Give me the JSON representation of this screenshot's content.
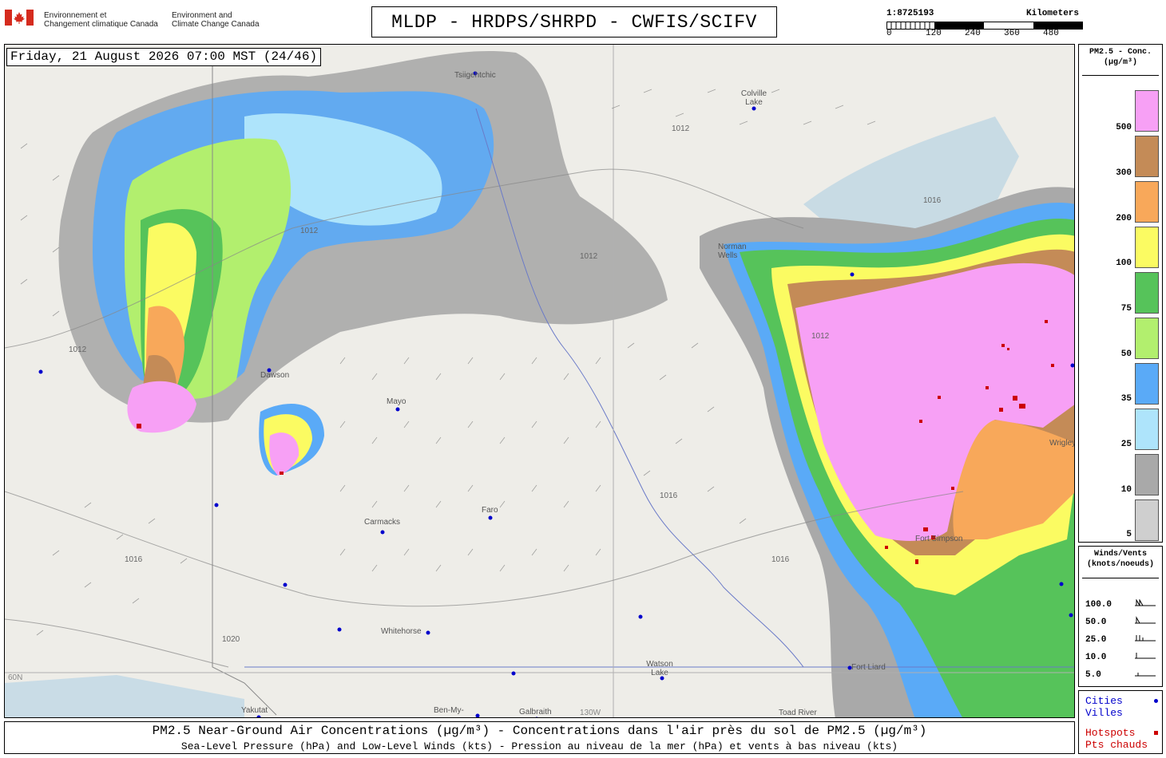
{
  "header": {
    "gov_fr_line1": "Environnement et",
    "gov_fr_line2": "Changement climatique Canada",
    "gov_en_line1": "Environment and",
    "gov_en_line2": "Climate Change Canada",
    "title": "MLDP - HRDPS/SHRPD - CWFIS/SCIFV",
    "scale_ratio": "1:8725193",
    "scale_unit": "Kilometers",
    "scale_ticks": [
      "0",
      "120",
      "240",
      "360",
      "480"
    ]
  },
  "datetime": "Friday, 21 August 2026 07:00 MST (24/46)",
  "map_labels": {
    "cities": [
      "Tsiigehtchic",
      "Colville Lake",
      "Mayo",
      "Dawson",
      "Carmacks",
      "Faro",
      "Whitehorse",
      "Watson Lake",
      "Fort Liard",
      "Yakutat",
      "Ben-My-",
      "Galbraith",
      "Toad River",
      "Norman Wells",
      "Fort Simpson",
      "Wrigley"
    ],
    "isobars": [
      "1012",
      "1016",
      "1020"
    ],
    "graticule": [
      "60N",
      "130W"
    ]
  },
  "legend": {
    "title_line1": "PM2.5 - Conc.",
    "title_line2": "(µg/m³)",
    "bins": [
      {
        "label": "500",
        "color": "#f7a0f5"
      },
      {
        "label": "300",
        "color": "#c48b57"
      },
      {
        "label": "200",
        "color": "#f8a85a"
      },
      {
        "label": "100",
        "color": "#fbfb62"
      },
      {
        "label": "75",
        "color": "#56c35a"
      },
      {
        "label": "50",
        "color": "#b2ef6e"
      },
      {
        "label": "35",
        "color": "#5aaaf7"
      },
      {
        "label": "25",
        "color": "#aee4fb"
      },
      {
        "label": "10",
        "color": "#a9a9a9"
      },
      {
        "label": "5",
        "color": "#cfcfcf"
      }
    ]
  },
  "winds": {
    "title_line1": "Winds/Vents",
    "title_line2": "(knots/noeuds)",
    "rows": [
      "100.0",
      "50.0",
      "25.0",
      "10.0",
      "5.0"
    ]
  },
  "key": {
    "cities_en": "Cities",
    "cities_fr": "Villes",
    "hotspots_en": "Hotspots",
    "hotspots_fr": "Pts chauds",
    "city_color": "#0000cc",
    "hotspot_color": "#cc0000"
  },
  "caption": {
    "line1": "PM2.5 Near-Ground Air Concentrations (µg/m³) - Concentrations dans l'air près du sol de PM2.5 (µg/m³)",
    "line2": "Sea-Level Pressure (hPa) and Low-Level Winds (kts) - Pression au niveau de la mer (hPa) et vents à bas niveau (kts)"
  }
}
